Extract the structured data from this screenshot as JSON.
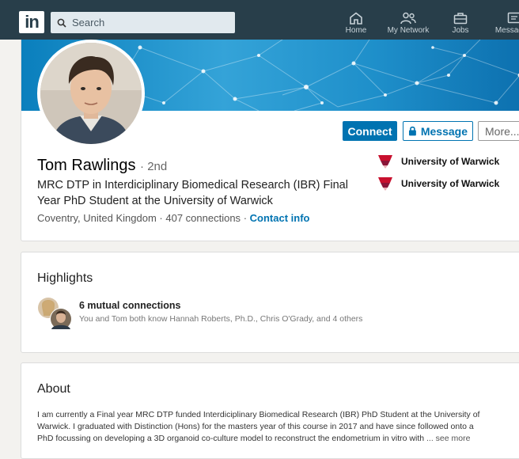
{
  "nav": {
    "logo": "in",
    "search_placeholder": "Search",
    "items": [
      {
        "label": "Home",
        "icon": "home-icon"
      },
      {
        "label": "My Network",
        "icon": "network-icon"
      },
      {
        "label": "Jobs",
        "icon": "jobs-icon"
      },
      {
        "label": "Messaging",
        "icon": "messaging-icon"
      }
    ]
  },
  "profile": {
    "name": "Tom Rawlings",
    "degree": "· 2nd",
    "headline": "MRC DTP in Interdiciplinary Biomedical Research (IBR) Final Year PhD Student at the University of Warwick",
    "location": "Coventry, United Kingdom",
    "separator": "·",
    "connections": "407 connections",
    "contact_info": "Contact info",
    "actions": {
      "connect": "Connect",
      "message": "Message",
      "more": "More..."
    },
    "education": [
      {
        "name": "University of Warwick"
      },
      {
        "name": "University of Warwick"
      }
    ]
  },
  "highlights": {
    "title": "Highlights",
    "mutual_title": "6 mutual connections",
    "mutual_desc": "You and Tom both know Hannah Roberts, Ph.D., Chris O'Grady, and 4 others"
  },
  "about": {
    "title": "About",
    "lines": [
      "I am currently a Final year MRC DTP funded Interdiciplinary Biomedical Research (IBR) PhD Student at the University of",
      "Warwick. I graduated with Distinction (Hons) for the masters year of this course in 2017 and have since followed onto a",
      "PhD focussing on developing a 3D organoid co-culture model to reconstruct the endometrium in vitro with"
    ],
    "see_more": "... see more"
  },
  "colors": {
    "nav_bg": "#283e4a",
    "accent": "#0073b1",
    "page_bg": "#f3f2ef",
    "warwick_red": "#c8102e"
  }
}
